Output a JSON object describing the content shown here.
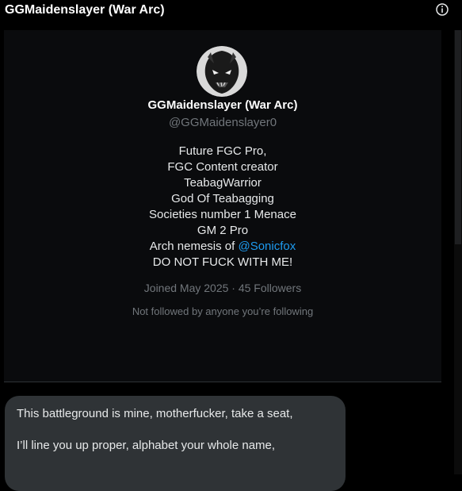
{
  "header": {
    "title": "GGMaidenslayer (War Arc)",
    "info_icon": "info-icon"
  },
  "profile": {
    "name": "GGMaidenslayer (War Arc)",
    "handle": "@GGMaidenslayer0",
    "bio_lines": [
      "Future FGC Pro,",
      "FGC Content creator",
      "TeabagWarrior",
      "God Of Teabagging",
      "Societies number 1 Menace",
      "GM 2 Pro"
    ],
    "bio_mention_prefix": "Arch nemesis of ",
    "bio_mention": "@Sonicfox",
    "bio_last_line": "DO NOT FUCK WITH ME!",
    "joined_meta": "Joined May 2025 · 45 Followers",
    "followed_status": "Not followed by anyone you’re following"
  },
  "message": {
    "line1": "This battleground is mine, motherfucker, take a seat,",
    "line2": "I’ll line you up proper, alphabet your whole name,"
  },
  "colors": {
    "background": "#000000",
    "card": "#0a0b0d",
    "bubble": "#2f3336",
    "mention": "#1d9bf0",
    "muted": "#71767b"
  }
}
